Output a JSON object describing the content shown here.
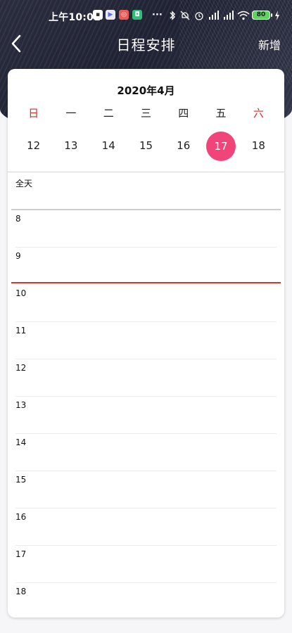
{
  "status_bar": {
    "time": "上午10:01",
    "more": "···",
    "battery": "80"
  },
  "nav": {
    "title": "日程安排",
    "add_label": "新增"
  },
  "calendar": {
    "month_title": "2020年4月",
    "weekdays": [
      "日",
      "一",
      "二",
      "三",
      "四",
      "五",
      "六"
    ],
    "dates": [
      "12",
      "13",
      "14",
      "15",
      "16",
      "17",
      "18"
    ],
    "selected_date": "17",
    "weekend_color": "#d0302a",
    "selected_color": "#f1457a"
  },
  "schedule": {
    "all_day_label": "全天",
    "hours": [
      "8",
      "9",
      "10",
      "11",
      "12",
      "13",
      "14",
      "15",
      "16",
      "17",
      "18"
    ],
    "current_time_line_color": "#c43a36"
  }
}
